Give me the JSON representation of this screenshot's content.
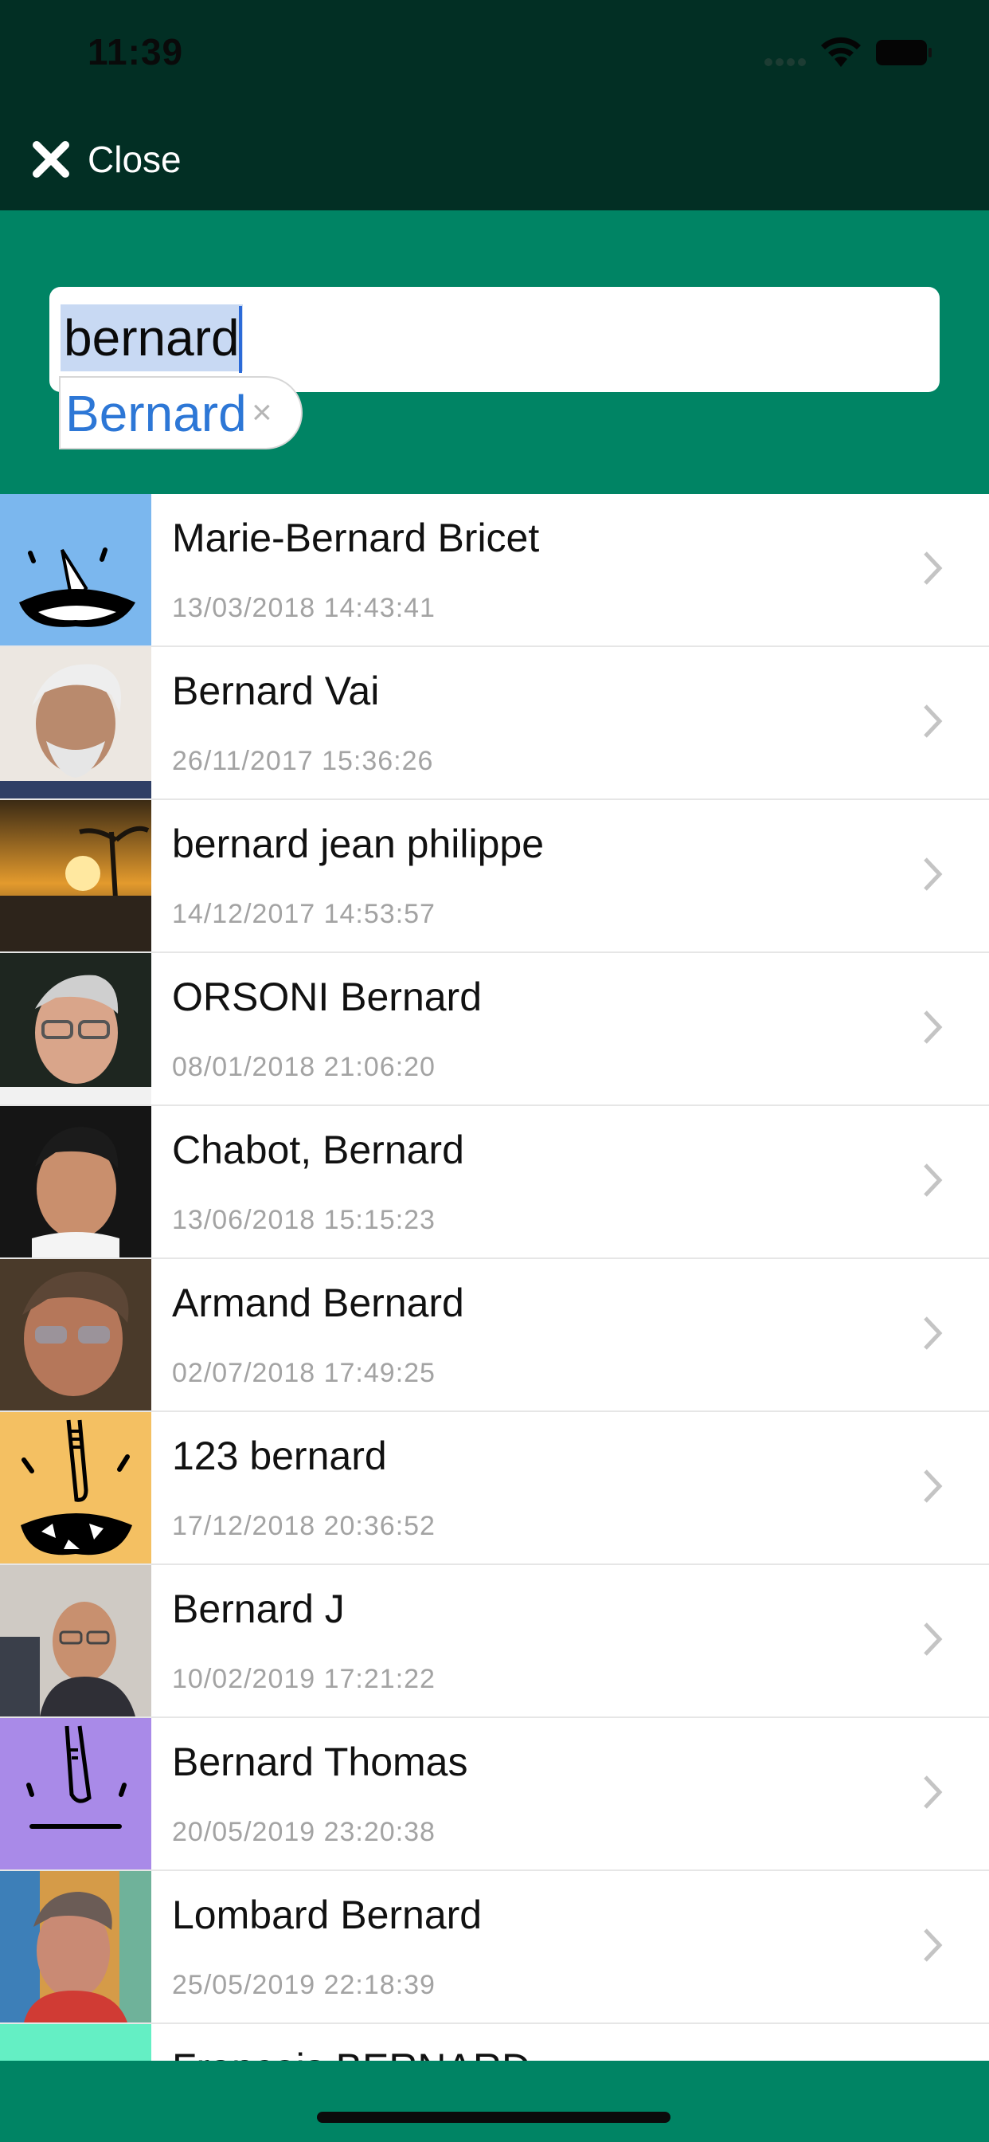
{
  "status_bar": {
    "time": "11:39"
  },
  "header": {
    "close_label": "Close"
  },
  "search": {
    "query": "bernard",
    "chip_label": "Bernard",
    "chip_remove": "×"
  },
  "results": [
    {
      "name": "Marie-Bernard Bricet",
      "date": "13/03/2018 14:43:41",
      "avatar": "cartoon-blue"
    },
    {
      "name": "Bernard Vai",
      "date": "26/11/2017 15:36:26",
      "avatar": "photo"
    },
    {
      "name": "bernard jean philippe",
      "date": "14/12/2017 14:53:57",
      "avatar": "sunset-photo"
    },
    {
      "name": "ORSONI Bernard",
      "date": "08/01/2018 21:06:20",
      "avatar": "photo"
    },
    {
      "name": "Chabot, Bernard",
      "date": "13/06/2018 15:15:23",
      "avatar": "photo"
    },
    {
      "name": "Armand Bernard",
      "date": "02/07/2018 17:49:25",
      "avatar": "photo"
    },
    {
      "name": "123 bernard",
      "date": "17/12/2018 20:36:52",
      "avatar": "cartoon-orange"
    },
    {
      "name": "Bernard J",
      "date": "10/02/2019 17:21:22",
      "avatar": "photo"
    },
    {
      "name": "Bernard Thomas",
      "date": "20/05/2019 23:20:38",
      "avatar": "cartoon-purple"
    },
    {
      "name": "Lombard Bernard",
      "date": "25/05/2019 22:18:39",
      "avatar": "photo"
    }
  ],
  "partial_result": {
    "name": "François BERNARD"
  },
  "colors": {
    "header_dark": "#022f24",
    "accent_green": "#008464",
    "chip_blue": "#2d77d6"
  }
}
